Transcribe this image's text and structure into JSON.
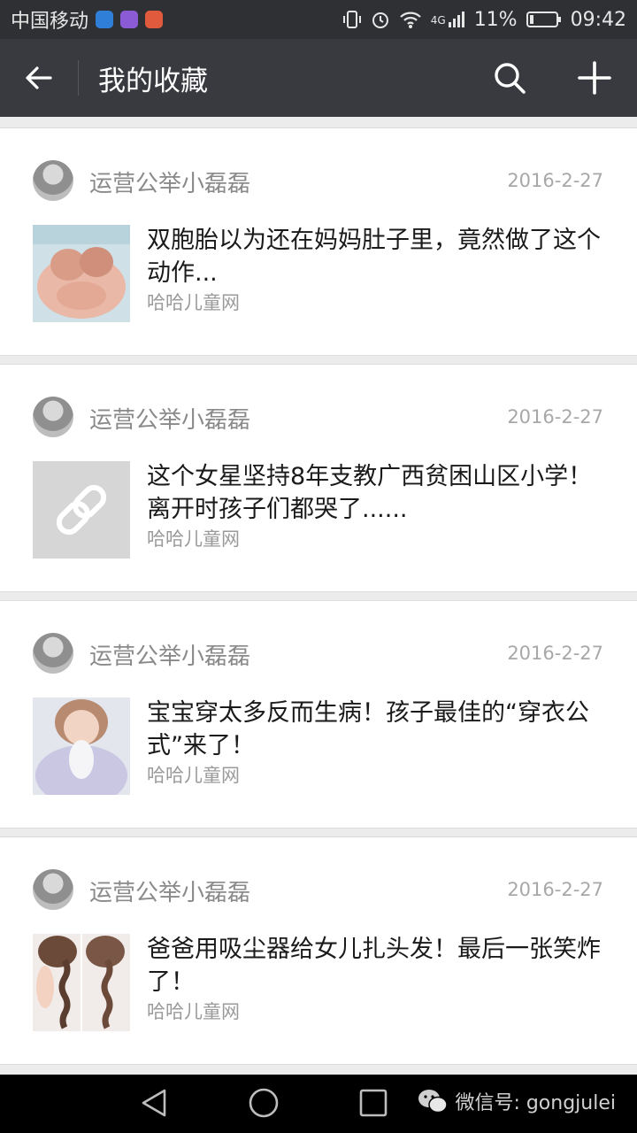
{
  "status_bar": {
    "carrier": "中国移动",
    "network": "4G",
    "battery": "11%",
    "time": "09:42"
  },
  "header": {
    "title": "我的收藏",
    "back_icon": "arrow-left-icon",
    "search_icon": "search-icon",
    "add_icon": "plus-icon"
  },
  "favorites": [
    {
      "author": "运营公举小磊磊",
      "date": "2016-2-27",
      "title": "双胞胎以为还在妈妈肚子里，竟然做了这个动作...",
      "source": "哈哈儿童网",
      "thumb": "twins-photo"
    },
    {
      "author": "运营公举小磊磊",
      "date": "2016-2-27",
      "title": "这个女星坚持8年支教广西贫困山区小学！离开时孩子们都哭了......",
      "source": "哈哈儿童网",
      "thumb": "link-icon"
    },
    {
      "author": "运营公举小磊磊",
      "date": "2016-2-27",
      "title": "宝宝穿太多反而生病！孩子最佳的“穿衣公式”来了！",
      "source": "哈哈儿童网",
      "thumb": "baby-photo"
    },
    {
      "author": "运营公举小磊磊",
      "date": "2016-2-27",
      "title": "爸爸用吸尘器给女儿扎头发！最后一张笑炸了！",
      "source": "哈哈儿童网",
      "thumb": "braid-photo"
    }
  ],
  "watermark": {
    "text": "微信号: gongjulei"
  },
  "colors": {
    "status_bar_bg": "#2f3034",
    "top_bar_bg": "#393a3f",
    "card_bg": "#ffffff",
    "page_bg": "#ececec"
  }
}
